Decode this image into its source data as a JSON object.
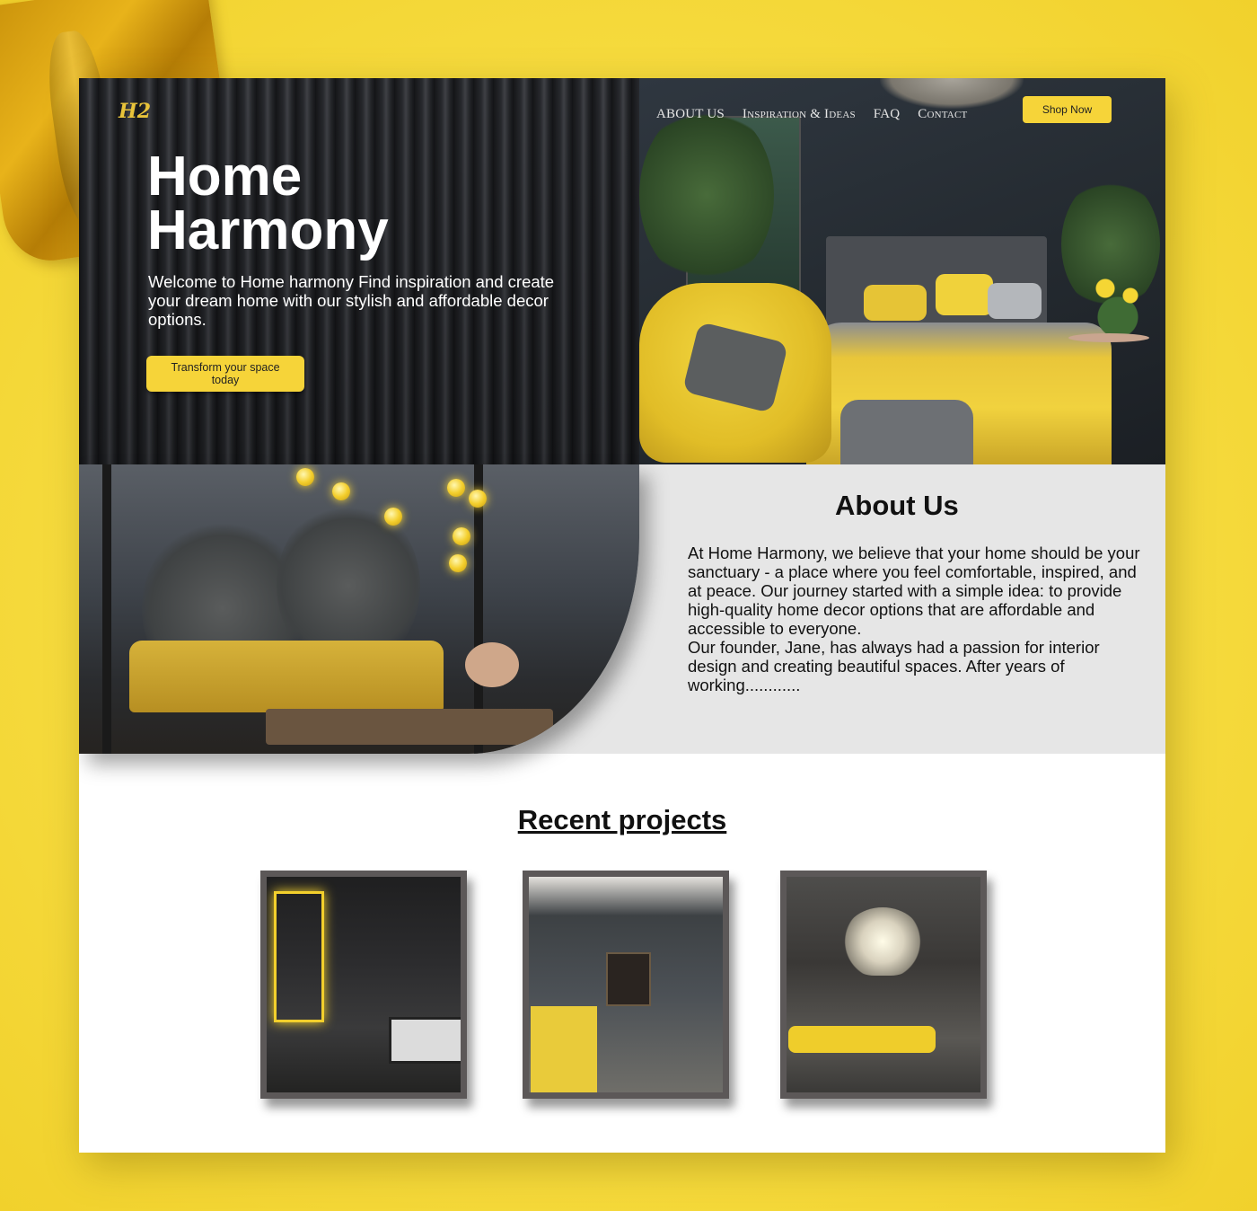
{
  "brand": {
    "logo_text": "H2"
  },
  "nav": {
    "items": [
      "ABOUT US",
      "Inspiration & Ideas",
      "FAQ",
      "Contact"
    ],
    "shop_label": "Shop Now"
  },
  "hero": {
    "title": "Home Harmony",
    "subtitle": "Welcome to Home harmony Find inspiration and create your dream home with our stylish and affordable decor options.",
    "cta_label": "Transform your space today"
  },
  "about": {
    "title": "About Us",
    "paragraph_1": "At Home Harmony, we believe that your home should be your sanctuary - a place where you feel comfortable, inspired, and at peace. Our journey started with a simple idea: to provide high-quality home decor options that are affordable and accessible to everyone.",
    "paragraph_2": "Our founder, Jane, has always had a passion for interior design and creating beautiful spaces. After years of working............"
  },
  "recent": {
    "title": "Recent projects",
    "projects": [
      "bathroom-project",
      "kitchen-project",
      "living-room-project"
    ]
  },
  "colors": {
    "accent": "#f6d439",
    "background": "#f6db3e",
    "dark": "#1a1b1e",
    "about_bg": "#e6e6e6"
  },
  "icons": [
    "logo-monogram-icon"
  ]
}
